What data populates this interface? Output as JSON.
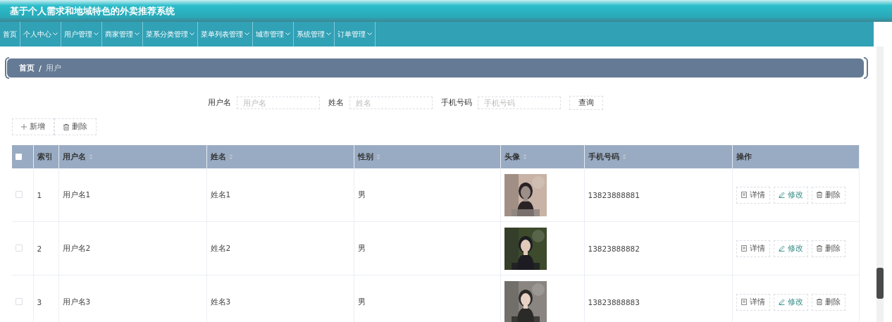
{
  "header": {
    "title": "基于个人需求和地域特色的外卖推荐系统"
  },
  "nav": [
    {
      "label": "首页",
      "dropdown": false
    },
    {
      "label": "个人中心",
      "dropdown": true
    },
    {
      "label": "用户管理",
      "dropdown": true
    },
    {
      "label": "商家管理",
      "dropdown": true
    },
    {
      "label": "菜系分类管理",
      "dropdown": true
    },
    {
      "label": "菜单列表管理",
      "dropdown": true
    },
    {
      "label": "城市管理",
      "dropdown": true
    },
    {
      "label": "系统管理",
      "dropdown": true
    },
    {
      "label": "订单管理",
      "dropdown": true
    }
  ],
  "breadcrumb": [
    "首页",
    "/",
    "用户"
  ],
  "search": {
    "fields": [
      {
        "label": "用户名",
        "placeholder": "用户名"
      },
      {
        "label": "姓名",
        "placeholder": "姓名"
      },
      {
        "label": "手机号码",
        "placeholder": "手机号码"
      }
    ],
    "button": "查询"
  },
  "actions": [
    {
      "kind": "add",
      "label": "新增"
    },
    {
      "kind": "delete",
      "label": "删除"
    }
  ],
  "table": {
    "select_all": false,
    "columns": [
      {
        "label": "索引",
        "sortable": false
      },
      {
        "label": "用户名",
        "sortable": true
      },
      {
        "label": "姓名",
        "sortable": true
      },
      {
        "label": "性别",
        "sortable": true
      },
      {
        "label": "头像",
        "sortable": true
      },
      {
        "label": "手机号码",
        "sortable": true
      },
      {
        "label": "操作",
        "sortable": false
      }
    ],
    "rows": [
      {
        "checked": false,
        "index": "1",
        "username": "用户名1",
        "name": "姓名1",
        "gender": "男",
        "phone": "13823888881",
        "buttons": [
          {
            "kind": "detail",
            "label": "详情"
          },
          {
            "kind": "edit",
            "label": "修改"
          },
          {
            "kind": "delete",
            "label": "删除"
          }
        ]
      },
      {
        "checked": false,
        "index": "2",
        "username": "用户名2",
        "name": "姓名2",
        "gender": "男",
        "phone": "13823888882",
        "buttons": [
          {
            "kind": "detail",
            "label": "详情"
          },
          {
            "kind": "edit",
            "label": "修改"
          },
          {
            "kind": "delete",
            "label": "删除"
          }
        ]
      },
      {
        "checked": false,
        "index": "3",
        "username": "用户名3",
        "name": "姓名3",
        "gender": "男",
        "phone": "13823888883",
        "buttons": [
          {
            "kind": "detail",
            "label": "详情"
          },
          {
            "kind": "edit",
            "label": "修改"
          },
          {
            "kind": "delete",
            "label": "删除"
          }
        ]
      }
    ]
  }
}
